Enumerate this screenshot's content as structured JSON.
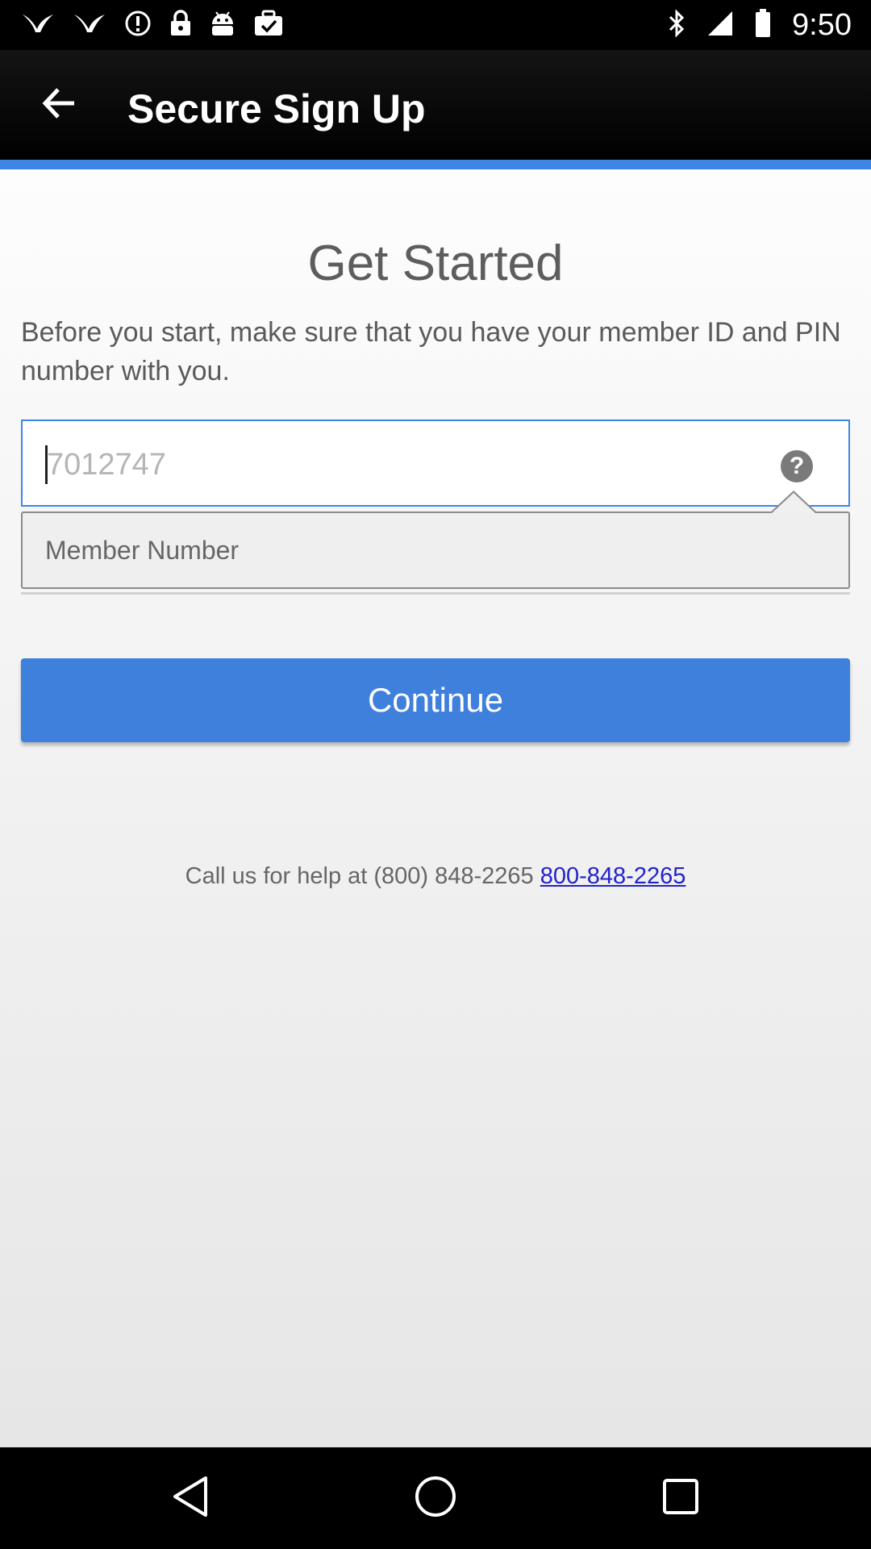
{
  "status_bar": {
    "time": "9:50",
    "left_icons": [
      "bird-icon",
      "bird-icon",
      "alert-icon",
      "lock-icon",
      "android-icon",
      "briefcase-check-icon"
    ],
    "right_icons": [
      "bluetooth-icon",
      "signal-icon",
      "battery-icon"
    ]
  },
  "app_bar": {
    "title": "Secure Sign Up",
    "back_icon": "arrow-left-icon"
  },
  "main": {
    "heading": "Get Started",
    "intro": "Before you start, make sure that you have your member ID and PIN number with you.",
    "member_field": {
      "value": "7012747",
      "help_icon": "question-icon",
      "help_glyph": "?"
    },
    "tooltip_text": "Member Number",
    "continue_label": "Continue",
    "help_text": "Call us for help at (800) 848-2265 ",
    "help_link": "800-848-2265"
  },
  "colors": {
    "accent": "#3d86e6",
    "button": "#3f80dc",
    "link": "#2222cc"
  },
  "nav_bar": {
    "icons": [
      "back-triangle-icon",
      "home-circle-icon",
      "recents-square-icon"
    ]
  }
}
